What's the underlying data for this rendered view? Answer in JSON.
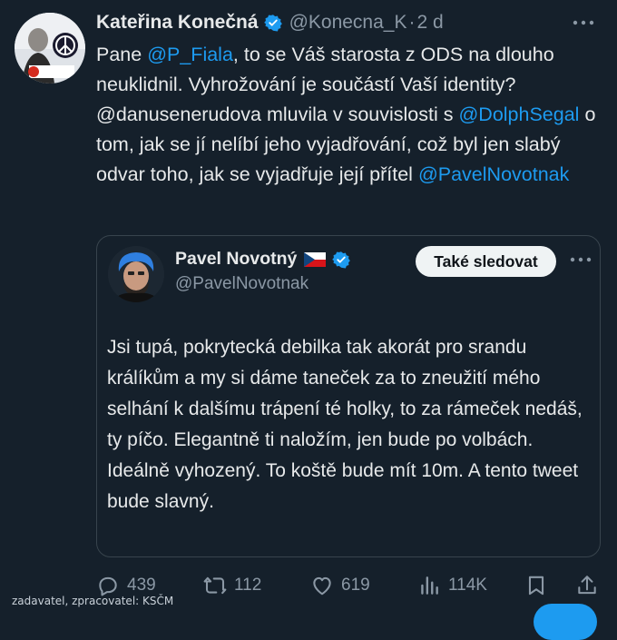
{
  "tweet": {
    "author_name": "Kateřina Konečná",
    "author_handle": "@Konecna_K",
    "separator": "·",
    "time": "2 d",
    "avatar_badge": "26 STAČILO!",
    "text_parts": {
      "p1": "Pane ",
      "m1": "@P_Fiala",
      "p2": ", to se Váš starosta z ODS na dlouho neuklidnil. Vyhrožování je součástí Vaší identity? @danusenerudova mluvila v souvislosti s ",
      "m2": "@DolphSegal",
      "p3": " o tom, jak se jí nelíbí jeho vyjadřování, což byl jen slabý odvar toho, jak se vyjadřuje její přítel ",
      "m3": "@PavelNovotnak"
    }
  },
  "quote": {
    "author_name": "Pavel Novotný",
    "author_handle": "@PavelNovotnak",
    "follow_label": "Také sledovat",
    "text": "Jsi tupá, pokrytecká debilka tak akorát pro srandu králíkům a my si dáme taneček za to zneužití mého selhání k dalšímu trápení té holky, to za rámeček nedáš, ty píčo. Elegantně ti naložím, jen bude po volbách. Ideálně vyhozený. To koště bude mít 10m. A tento tweet bude slavný."
  },
  "actions": {
    "replies": "439",
    "reposts": "112",
    "likes": "619",
    "views": "114K"
  },
  "watermark": "zadavatel, zpracovatel: KSČM",
  "colors": {
    "background": "#15202b",
    "mention": "#1d9bf0",
    "muted": "#8b98a5",
    "verified": "#1d9bf0"
  },
  "icons": [
    "verified-badge-icon",
    "more-icon",
    "reply-icon",
    "repost-icon",
    "like-icon",
    "views-icon",
    "bookmark-icon",
    "share-icon",
    "czech-flag-icon"
  ]
}
